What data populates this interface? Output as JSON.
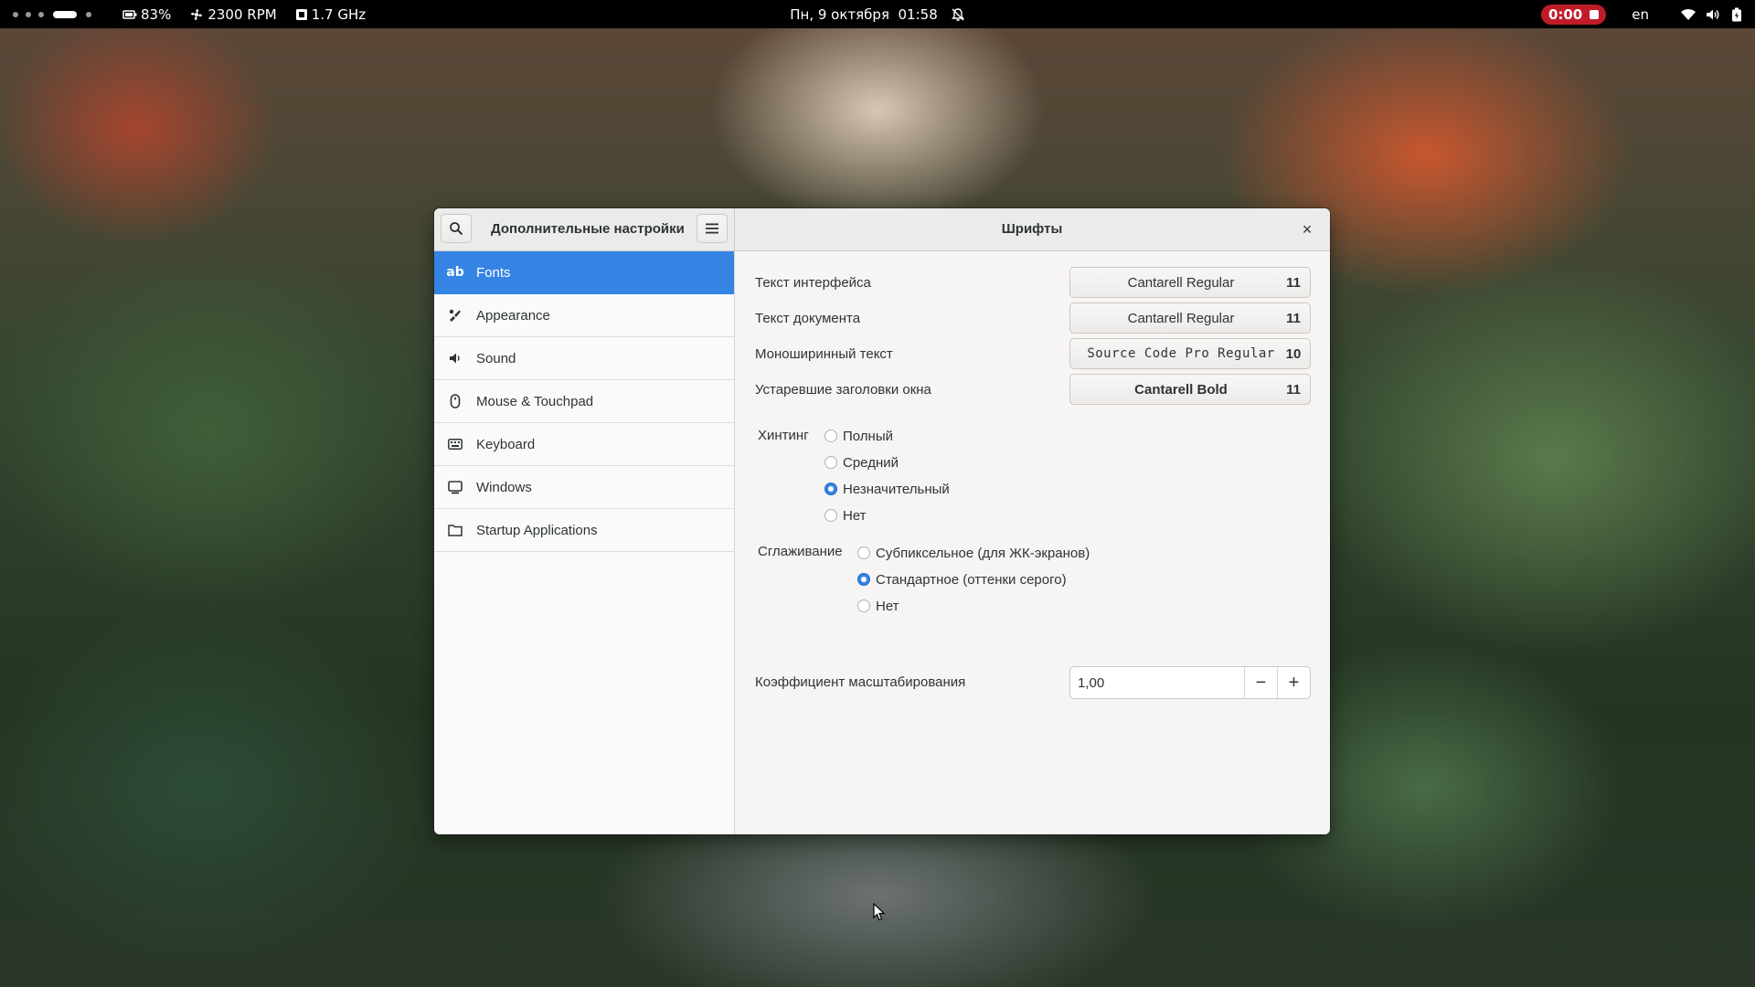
{
  "topbar": {
    "battery": "83%",
    "fan": "2300 RPM",
    "cpu_freq": "1.7 GHz",
    "datetime": "Пн, 9 октября  01:58",
    "recording_time": "0:00",
    "keyboard_layout": "en",
    "icons": [
      "activities-workspaces",
      "battery-icon",
      "fan-icon",
      "cpu-icon",
      "bell-off-icon",
      "record-stop-icon",
      "wifi-icon",
      "volume-icon",
      "battery-status-icon"
    ]
  },
  "window": {
    "app_title": "Дополнительные настройки",
    "page_title": "Шрифты",
    "close_glyph": "×"
  },
  "sidebar": {
    "items": [
      {
        "label": "Fonts",
        "icon": "fonts-icon",
        "active": true
      },
      {
        "label": "Appearance",
        "icon": "appearance-icon"
      },
      {
        "label": "Sound",
        "icon": "sound-icon"
      },
      {
        "label": "Mouse & Touchpad",
        "icon": "mouse-icon"
      },
      {
        "label": "Keyboard",
        "icon": "keyboard-icon"
      },
      {
        "label": "Windows",
        "icon": "windows-icon"
      },
      {
        "label": "Startup Applications",
        "icon": "folder-icon"
      }
    ]
  },
  "fonts": {
    "interface": {
      "label": "Текст интерфейса",
      "font": "Cantarell Regular",
      "size": "11"
    },
    "document": {
      "label": "Текст документа",
      "font": "Cantarell Regular",
      "size": "11"
    },
    "monospace": {
      "label": "Моноширинный текст",
      "font": "Source Code Pro Regular",
      "size": "10"
    },
    "legacy_titles": {
      "label": "Устаревшие заголовки окна",
      "font": "Cantarell Bold",
      "size": "11"
    }
  },
  "hinting": {
    "label": "Хинтинг",
    "options": [
      "Полный",
      "Средний",
      "Незначительный",
      "Нет"
    ],
    "selected": "Незначительный"
  },
  "antialiasing": {
    "label": "Сглаживание",
    "options": [
      "Субпиксельное (для ЖК-экранов)",
      "Стандартное (оттенки серого)",
      "Нет"
    ],
    "selected": "Стандартное (оттенки серого)"
  },
  "scaling": {
    "label": "Коэффициент масштабирования",
    "value": "1,00",
    "minus": "−",
    "plus": "+"
  },
  "colors": {
    "accent": "#3584e4",
    "topbar": "#000000",
    "recording": "#c01c28"
  }
}
